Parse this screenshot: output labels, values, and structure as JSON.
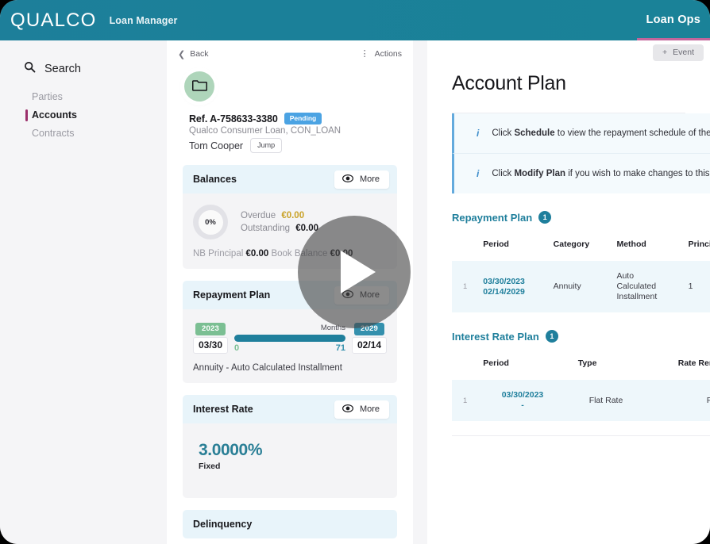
{
  "topbar": {
    "brand": "QUALCO",
    "app_name": "Loan Manager",
    "user_menu": "Loan Ops",
    "accent_underline": "#c2659b",
    "background": "#1a8298"
  },
  "sidebar": {
    "search_label": "Search",
    "search_icon": "search-icon",
    "items": [
      {
        "label": "Parties",
        "active": false
      },
      {
        "label": "Accounts",
        "active": true
      },
      {
        "label": "Contracts",
        "active": false
      }
    ],
    "active_marker_color": "#9b2f6b"
  },
  "mid_panel": {
    "back_label": "Back",
    "actions_label": "Actions",
    "avatar_icon": "folder-icon",
    "account": {
      "reference": "Ref. A-758633-3380",
      "status_badge": "Pending",
      "status_color": "#4ba3e3",
      "product": "Qualco Consumer Loan, CON_LOAN",
      "owner": "Tom Cooper",
      "jump_label": "Jump"
    },
    "balances": {
      "title": "Balances",
      "more_label": "More",
      "more_icon": "eye-icon",
      "percent": "0%",
      "overdue_label": "Overdue",
      "overdue_value": "€0.00",
      "outstanding_label": "Outstanding",
      "outstanding_value": "€0.00",
      "nb_principal_label": "NB Principal",
      "nb_principal_value": "€0.00",
      "book_balance_label": "Book Balance",
      "book_balance_value": "€0.00"
    },
    "repayment_plan": {
      "title": "Repayment Plan",
      "more_label": "More",
      "start_year": "2023",
      "start_date": "03/30",
      "end_year": "2029",
      "end_date": "02/14",
      "bar_label": "Months",
      "tick_min": "0",
      "tick_max": "71",
      "footer": "Annuity - Auto Calculated Installment"
    },
    "interest_rate": {
      "title": "Interest Rate",
      "more_label": "More",
      "value": "3.0000%",
      "type": "Fixed"
    },
    "delinquency": {
      "title": "Delinquency"
    }
  },
  "right_panel": {
    "event_button": "Event",
    "event_icon": "plus-icon",
    "page_title": "Account Plan",
    "alerts": [
      {
        "icon": "info-icon",
        "prefix": "Click ",
        "strong": "Schedule",
        "suffix": " to view the repayment schedule of the loa"
      },
      {
        "icon": "info-icon",
        "prefix": "Click ",
        "strong": "Modify Plan",
        "suffix": " if you wish to make changes to this Pla"
      }
    ],
    "repayment_plan_section": {
      "title": "Repayment Plan",
      "count": "1",
      "columns": [
        "Period",
        "Category",
        "Method",
        "Principal Frequen"
      ],
      "rows": [
        {
          "index": "1",
          "period_from": "03/30/2023",
          "period_to": "02/14/2029",
          "category": "Annuity",
          "method": "Auto Calculated Installment",
          "principal_frequency": "1"
        }
      ]
    },
    "interest_rate_plan_section": {
      "title": "Interest Rate Plan",
      "count": "1",
      "columns": [
        "Period",
        "Type",
        "Rate Renewal"
      ],
      "rows": [
        {
          "index": "1",
          "period_from": "03/30/2023",
          "period_to": "-",
          "type": "Flat Rate",
          "rate_renewal": "Fixed"
        }
      ]
    }
  },
  "overlay": {
    "play_icon": "play-icon"
  }
}
